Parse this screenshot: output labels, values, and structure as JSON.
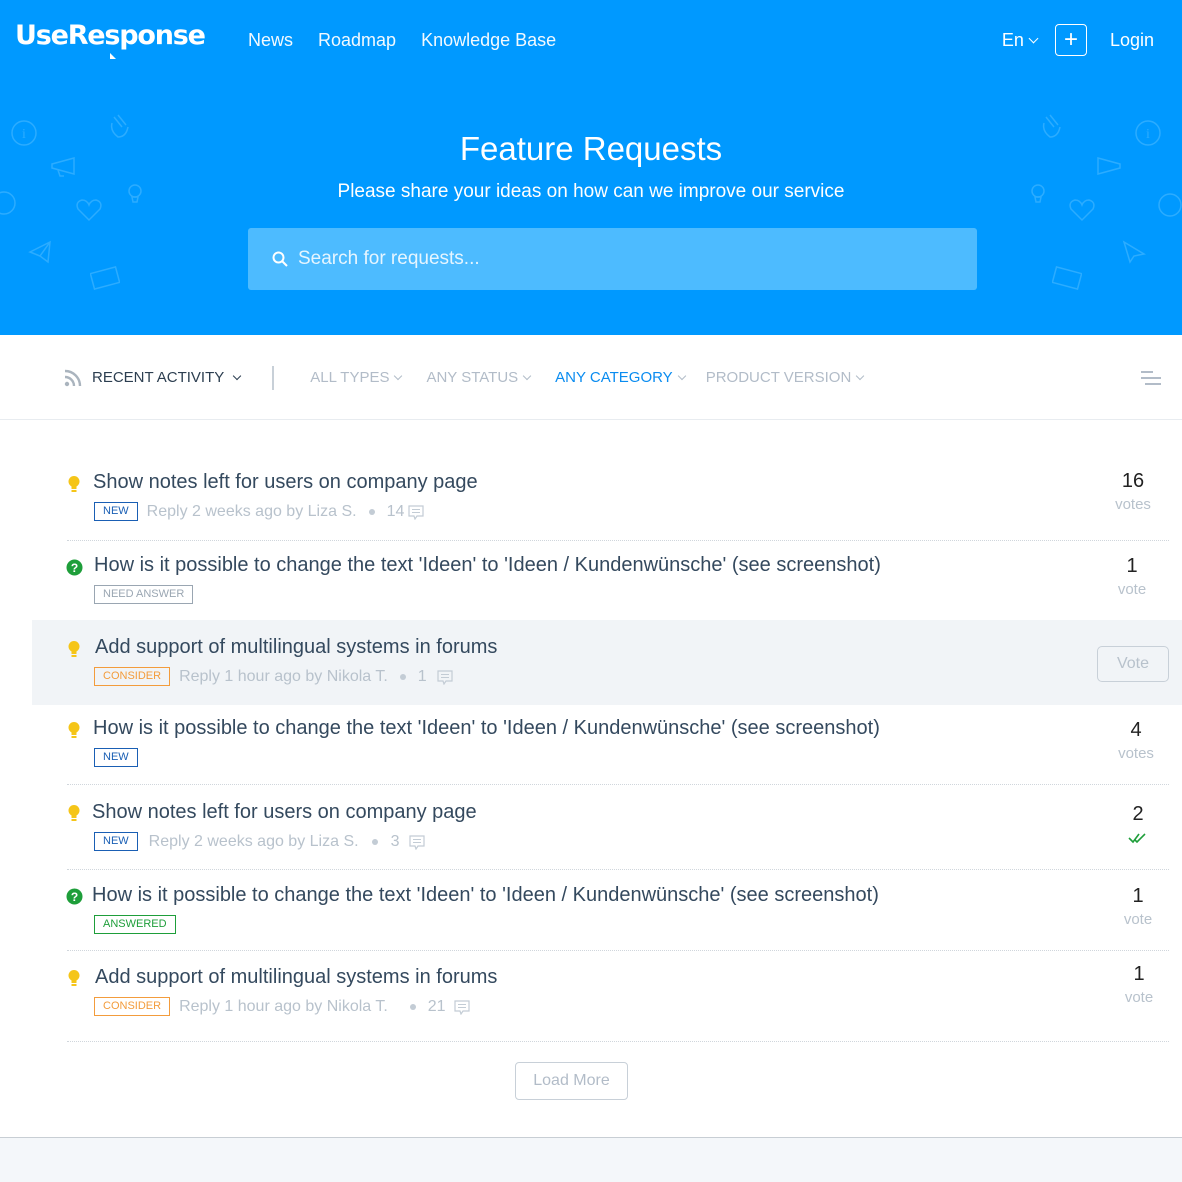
{
  "header": {
    "logo": "UseResponse",
    "nav": [
      "News",
      "Roadmap",
      "Knowledge Base"
    ],
    "language": "En",
    "login": "Login"
  },
  "hero": {
    "title": "Feature Requests",
    "subtitle": "Please share your ideas on how can we improve our service",
    "search_placeholder": "Search for requests..."
  },
  "filters": {
    "sort": "RECENT ACTIVITY",
    "types": "ALL TYPES",
    "status": "ANY STATUS",
    "category": "ANY CATEGORY",
    "version": "PRODUCT VERSION"
  },
  "colors": {
    "brand": "#0099ff",
    "active_filter": "#0a8cf0",
    "idea": "#f5c518",
    "question": "#1e9e3a"
  },
  "items": [
    {
      "icon": "lightbulb",
      "title": "Show notes left for users on company page",
      "badge": "NEW",
      "meta": "Reply 2 weeks ago by Liza S.",
      "comments": "14",
      "votes": "16",
      "votes_label": "votes"
    },
    {
      "icon": "question",
      "title": "How is it possible to change the text 'Ideen' to 'Ideen / Kundenwünsche' (see screenshot)",
      "badge": "NEED ANSWER",
      "votes": "1",
      "votes_label": "vote"
    },
    {
      "icon": "lightbulb",
      "title": "Add support of multilingual systems in forums",
      "badge": "CONSIDER",
      "meta": "Reply 1 hour ago by Nikola T.",
      "comments": "1",
      "vote_button": "Vote"
    },
    {
      "icon": "lightbulb",
      "title": "How is it possible to change the text 'Ideen' to 'Ideen / Kundenwünsche' (see screenshot)",
      "badge": "NEW",
      "votes": "4",
      "votes_label": "votes"
    },
    {
      "icon": "lightbulb",
      "title": "Show notes left for users on company page",
      "badge": "NEW",
      "meta": "Reply 2 weeks ago by Liza S.",
      "comments": "3",
      "votes": "2",
      "voted": true
    },
    {
      "icon": "question",
      "title": "How is it possible to change the text 'Ideen' to 'Ideen / Kundenwünsche' (see screenshot)",
      "badge": "ANSWERED",
      "votes": "1",
      "votes_label": "vote"
    },
    {
      "icon": "lightbulb",
      "title": "Add support of multilingual systems in forums",
      "badge": "CONSIDER",
      "meta": "Reply 1 hour ago by Nikola T.",
      "comments": "21",
      "votes": "1",
      "votes_label": "vote"
    }
  ],
  "load_more": "Load More"
}
